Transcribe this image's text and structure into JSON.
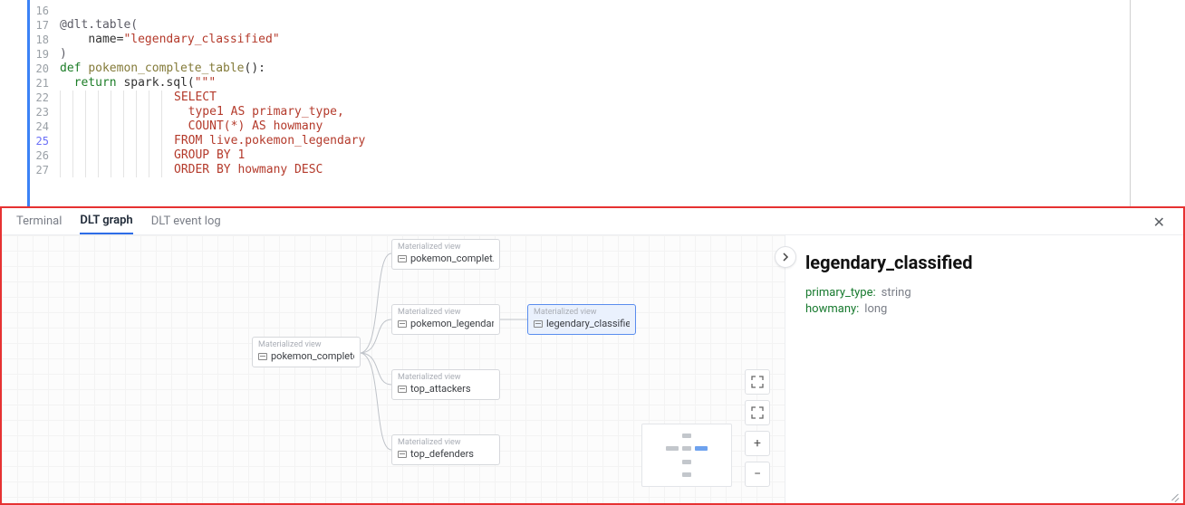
{
  "editor": {
    "lines": [
      {
        "num": "16",
        "segs": []
      },
      {
        "num": "17",
        "segs": [
          {
            "t": "@dlt.table(",
            "c": "tok-dec"
          }
        ]
      },
      {
        "num": "18",
        "segs": [
          {
            "t": "    ",
            "c": "tok-plain"
          },
          {
            "t": "name",
            "c": "tok-plain"
          },
          {
            "t": "=",
            "c": "tok-plain"
          },
          {
            "t": "\"legendary_classified\"",
            "c": "tok-str"
          }
        ]
      },
      {
        "num": "19",
        "segs": [
          {
            "t": ")",
            "c": "tok-dec"
          }
        ]
      },
      {
        "num": "20",
        "segs": [
          {
            "t": "def ",
            "c": "tok-kw"
          },
          {
            "t": "pokemon_complete_table",
            "c": "tok-fn"
          },
          {
            "t": "():",
            "c": "tok-plain"
          }
        ]
      },
      {
        "num": "21",
        "segs": [
          {
            "t": "  ",
            "c": "tok-plain"
          },
          {
            "t": "return ",
            "c": "tok-kw"
          },
          {
            "t": "spark.sql(",
            "c": "tok-plain"
          },
          {
            "t": "\"\"\"",
            "c": "tok-str"
          }
        ]
      },
      {
        "num": "22",
        "guides": 9,
        "segs": [
          {
            "t": "SELECT",
            "c": "tok-str"
          }
        ]
      },
      {
        "num": "23",
        "guides": 9,
        "segs": [
          {
            "t": "  type1 AS primary_type,",
            "c": "tok-str"
          }
        ]
      },
      {
        "num": "24",
        "guides": 9,
        "segs": [
          {
            "t": "  COUNT(*) AS howmany",
            "c": "tok-str"
          }
        ]
      },
      {
        "num": "25",
        "hl": true,
        "guides": 9,
        "segs": [
          {
            "t": "FROM live.pokemon_legendary",
            "c": "tok-str"
          }
        ]
      },
      {
        "num": "26",
        "guides": 9,
        "segs": [
          {
            "t": "GROUP BY 1",
            "c": "tok-str"
          }
        ]
      },
      {
        "num": "27",
        "guides": 9,
        "segs": [
          {
            "t": "ORDER BY howmany DESC",
            "c": "tok-str"
          }
        ]
      }
    ]
  },
  "panel": {
    "tabs": {
      "terminal": "Terminal",
      "dlt_graph": "DLT graph",
      "dlt_event_log": "DLT event log"
    }
  },
  "graph": {
    "node_type_label": "Materialized view",
    "nodes": {
      "pokemon_complete": "pokemon_complete",
      "pokemon_complet": "pokemon_complet...",
      "pokemon_legendary": "pokemon_legendary",
      "top_attackers": "top_attackers",
      "top_defenders": "top_defenders",
      "legendary_classified": "legendary_classified"
    }
  },
  "detail": {
    "title": "legendary_classified",
    "schema": [
      {
        "k": "primary_type:",
        "v": "string"
      },
      {
        "k": "howmany:",
        "v": "long"
      }
    ]
  },
  "controls": {
    "fit": "⤢",
    "full": "⛶",
    "plus": "+",
    "minus": "−"
  }
}
